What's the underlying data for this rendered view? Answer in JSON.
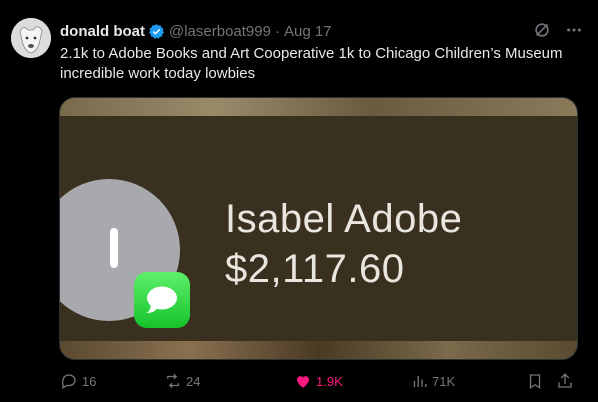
{
  "author": {
    "name": "donald boat",
    "handle": "@laserboat999",
    "separator": "·",
    "date": "Aug 17"
  },
  "post": {
    "text_line1": "2.1k to Adobe Books and Art Cooperative 1k to Chicago Children’s Museum",
    "text_line2": "incredible work today lowbies"
  },
  "media": {
    "contact_name": "Isabel Adobe",
    "amount": "$2,117.60",
    "initial": "I"
  },
  "actions": {
    "replies": "16",
    "reposts": "24",
    "likes": "1.9K",
    "views": "71K"
  },
  "colors": {
    "background": "#000000",
    "text": "#e7e9ea",
    "muted": "#71767b",
    "verified": "#1d9bf0",
    "like": "#f91880"
  },
  "icons": [
    "grok-icon",
    "more-icon",
    "reply-icon",
    "repost-icon",
    "like-icon",
    "views-icon",
    "bookmark-icon",
    "share-icon"
  ]
}
